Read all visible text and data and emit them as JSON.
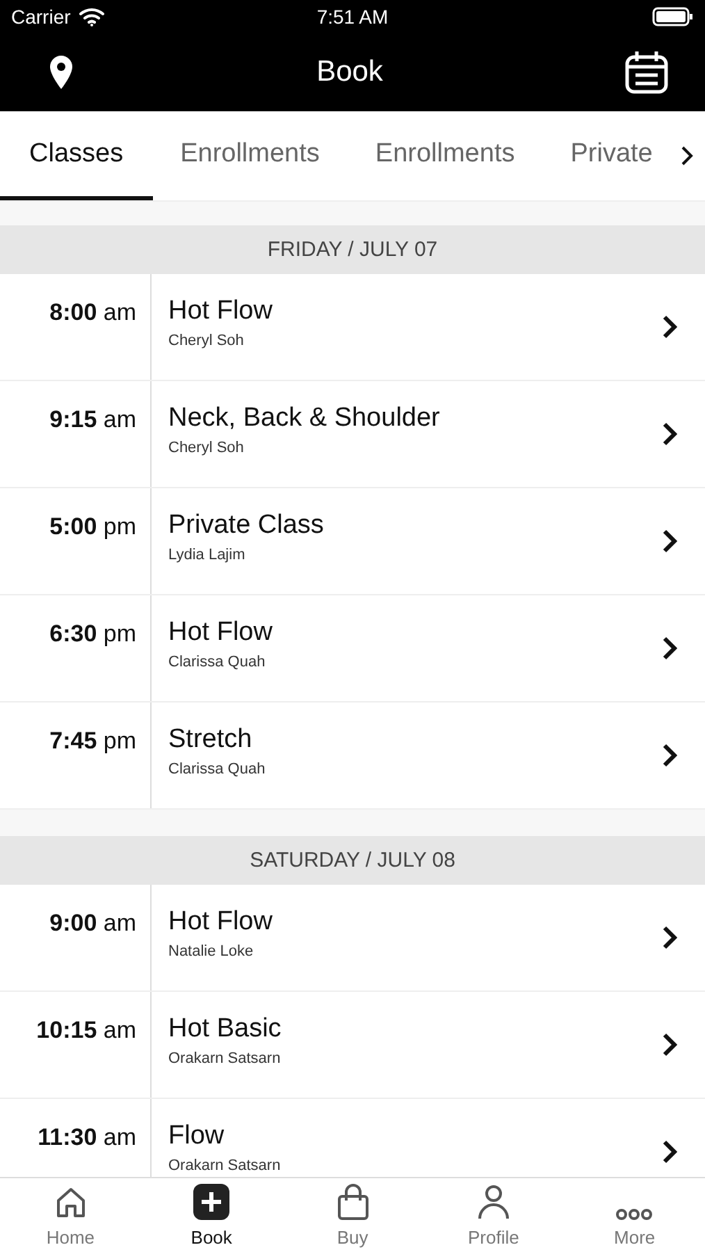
{
  "status_bar": {
    "carrier": "Carrier",
    "time": "7:51 AM"
  },
  "header": {
    "title": "Book"
  },
  "tabs": [
    {
      "label": "Classes",
      "selected": true
    },
    {
      "label": "Enrollments",
      "selected": false
    },
    {
      "label": "Enrollments",
      "selected": false
    },
    {
      "label": "Private",
      "selected": false
    }
  ],
  "days": [
    {
      "heading": "FRIDAY / JULY 07",
      "classes": [
        {
          "time": "**8:00** am",
          "name": "Hot Flow",
          "instructor": "Cheryl Soh"
        },
        {
          "time": "**9:15** am",
          "name": "Neck, Back & Shoulder",
          "instructor": "Cheryl Soh"
        },
        {
          "time": "**5:00** pm",
          "name": "Private Class",
          "instructor": "Lydia Lajim"
        },
        {
          "time": "**6:30** pm",
          "name": "Hot Flow",
          "instructor": "Clarissa Quah"
        },
        {
          "time": "**7:45** pm",
          "name": "Stretch",
          "instructor": "Clarissa Quah"
        }
      ]
    },
    {
      "heading": "SATURDAY / JULY 08",
      "classes": [
        {
          "time": "**9:00** am",
          "name": "Hot Flow",
          "instructor": "Natalie Loke"
        },
        {
          "time": "**10:15** am",
          "name": "Hot Basic",
          "instructor": "Orakarn Satsarn"
        },
        {
          "time": "**11:30** am",
          "name": "Flow",
          "instructor": "Orakarn Satsarn"
        }
      ]
    }
  ],
  "nav": [
    {
      "label": "Home",
      "selected": false
    },
    {
      "label": "Book",
      "selected": true
    },
    {
      "label": "Buy",
      "selected": false
    },
    {
      "label": "Profile",
      "selected": false
    },
    {
      "label": "More",
      "selected": false
    }
  ]
}
